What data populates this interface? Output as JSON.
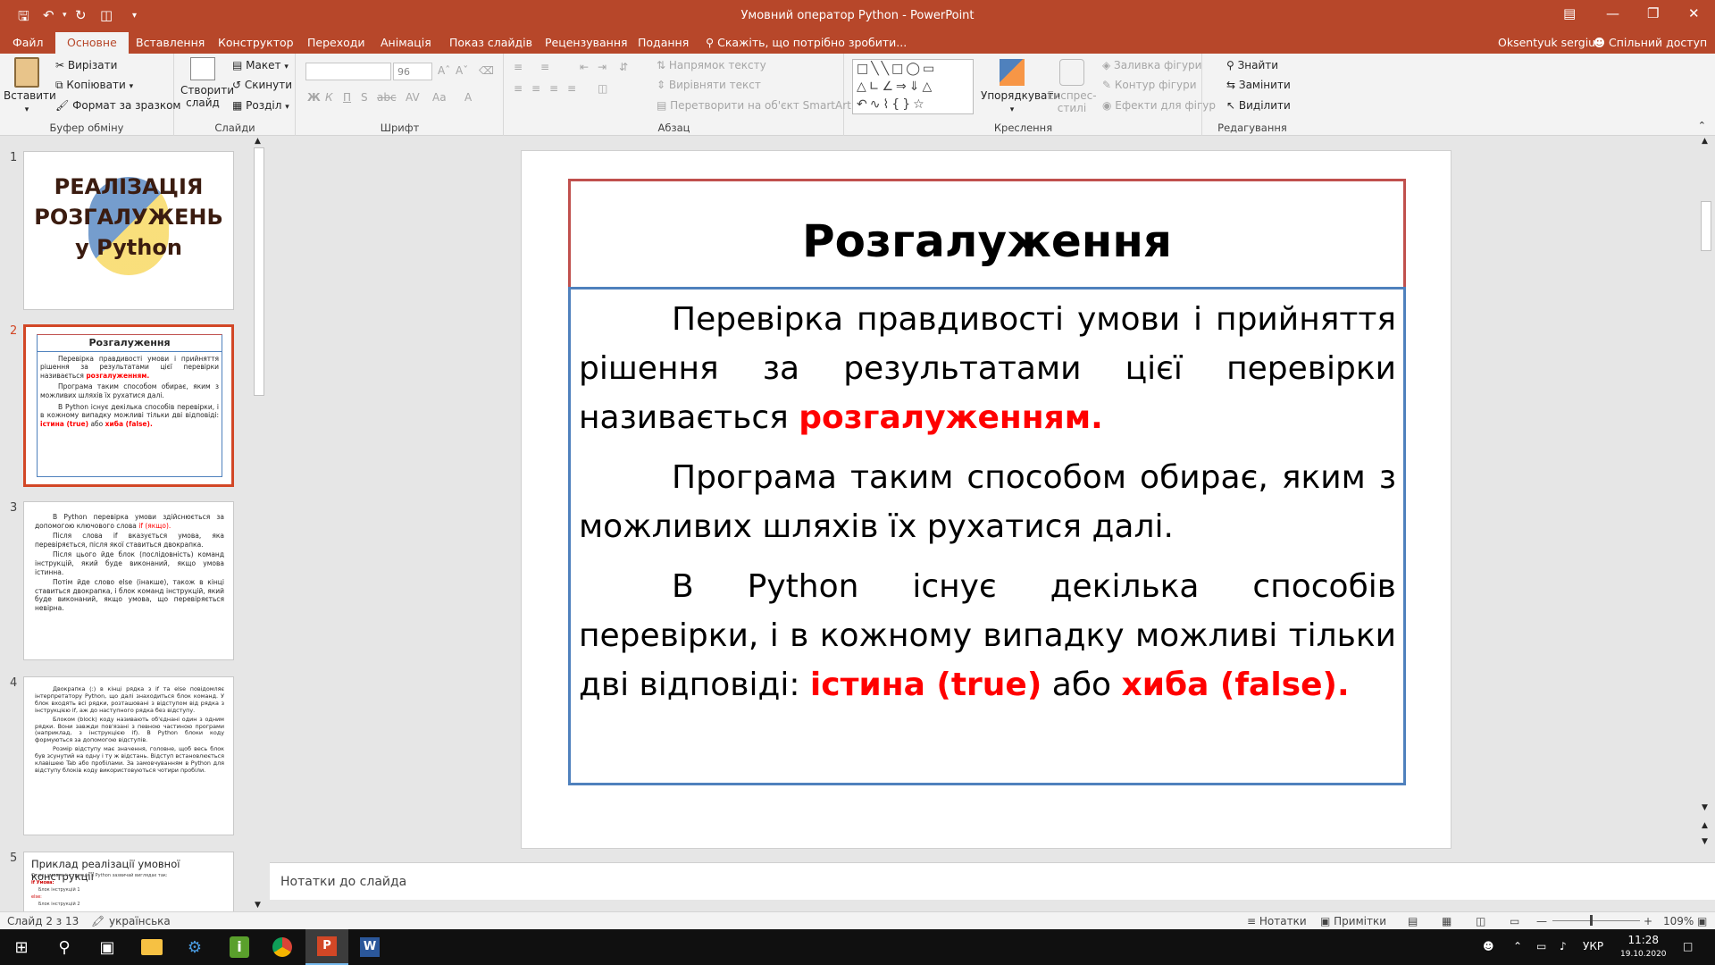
{
  "window": {
    "title": "Умовний оператор Python - PowerPoint"
  },
  "tabs": [
    "Файл",
    "Основне",
    "Вставлення",
    "Конструктор",
    "Переходи",
    "Анімація",
    "Показ слайдів",
    "Рецензування",
    "Подання"
  ],
  "tell_me": "Скажіть, що потрібно зробити...",
  "user": "Oksentyuk sergiu",
  "share": "Спільний доступ",
  "ribbon": {
    "clipboard": {
      "paste": "Вставити",
      "cut": "Вирізати",
      "copy": "Копіювати",
      "format": "Формат за зразком",
      "label": "Буфер обміну"
    },
    "slides": {
      "new_slide_1": "Створити",
      "new_slide_2": "слайд",
      "layout": "Макет",
      "reset": "Скинути",
      "section": "Розділ",
      "label": "Слайди"
    },
    "font": {
      "size": "96",
      "label": "Шрифт"
    },
    "paragraph": {
      "direction": "Напрямок тексту",
      "align": "Вирівняти текст",
      "smartart": "Перетворити на об'єкт SmartArt",
      "label": "Абзац"
    },
    "drawing": {
      "arrange": "Упорядкувати",
      "styles_1": "Експрес-",
      "styles_2": "стилі",
      "fill": "Заливка фігури",
      "outline": "Контур фігури",
      "effects": "Ефекти для фігур",
      "label": "Креслення"
    },
    "editing": {
      "find": "Знайти",
      "replace": "Замінити",
      "select": "Виділити",
      "label": "Редагування"
    }
  },
  "thumbnails": {
    "nums": [
      "1",
      "2",
      "3",
      "4",
      "5"
    ],
    "s1": {
      "title": "РЕАЛІЗАЦІЯ РОЗГАЛУЖЕНЬ у Python"
    },
    "s2": {
      "title": "Розгалуження",
      "p1": "Перевірка правдивості умови і прийняття рішення за результатами цієї перевірки називається",
      "p1r": "розгалуженням.",
      "p2": "Програма таким способом обирає, яким з можливих шляхів їх рухатися далі.",
      "p3": "В Python існує декілька способів перевірки, і в кожному випадку можливі тільки дві відповіді:",
      "p3a": "істина (true)",
      "p3b": "або",
      "p3c": "хиба (false)."
    },
    "s3": {
      "p1": "В Python перевірка умови здійснюється за допомогою ключового слова",
      "p1r": "if (якщо).",
      "p2": "Після слова if вказується умова, яка перевіряється, після якої ставиться двокрапка.",
      "p3": "Після цього йде блок (послідовність) команд інструкцій, який буде виконаний, якщо умова істинна.",
      "p4": "Потім йде слово else (інакше), також в кінці ставиться двокрапка, і блок команд інструкцій, який буде виконаний, якщо умова, що перевіряється невірна."
    },
    "s4": {
      "p1": "Двокрапка (:) в кінці рядка з if та else повідомляє інтерпретатору Python, що далі знаходиться блок команд. У блок входять всі рядки, розташовані з відступом від рядка з інструкцією if, аж до наступного рядка без відступу.",
      "p2": "Блоком (block) коду називають об'єднані один з одним рядки. Вони завжди пов'язані з певною частиною програми (наприклад, з інструкцією if). В Python блоки коду формуються за допомогою відступів.",
      "p3": "Розмір відступу має значення, головне, щоб весь блок був зсунутий на одну і ту ж відстань. Відступ встановлюється клавішею Tab або пробілами. За замовчуванням в Python для відступу блоків коду використовуються чотири пробіли."
    },
    "s5": {
      "title": "Приклад реалізації умовної конструкції",
      "line1": "Отже, умовна інструкція в Python зазвичай виглядає так:",
      "line2": "if Умова:",
      "line3": "Блок інструкцій 1",
      "line4": "else:",
      "line5": "Блок інструкцій 2"
    }
  },
  "slide": {
    "title": "Розгалуження",
    "p1": "Перевірка правдивості умови і прийняття рішення за результатами цієї перевірки називається ",
    "p1r": "розгалуженням.",
    "p2": "Програма таким способом обирає, яким з можливих шляхів їх рухатися далі.",
    "p3": "В Python існує  декілька способів перевірки, і в кожному випадку можливі тільки дві відповіді: ",
    "p3a": "істина (true)",
    "p3b": " або ",
    "p3c": "хиба (false)."
  },
  "notes_placeholder": "Нотатки до слайда",
  "status": {
    "slide": "Слайд 2 з 13",
    "lang": "українська",
    "notes": "Нотатки",
    "comments": "Примітки",
    "zoom": "109%"
  },
  "taskbar": {
    "lang": "УКР",
    "time": "11:28",
    "date": "19.10.2020"
  },
  "colors": {
    "accent": "#b7472a",
    "title_border": "#c0504d",
    "body_border": "#4f81bd",
    "red_text": "#ff0000"
  }
}
